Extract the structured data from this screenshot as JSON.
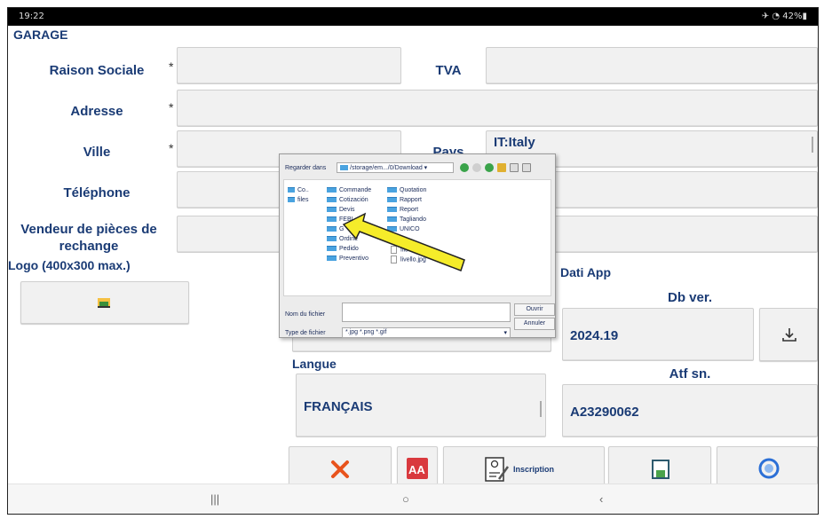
{
  "status_bar": {
    "time": "19:22",
    "battery": "42%"
  },
  "app": {
    "title": "GARAGE"
  },
  "form": {
    "raison_sociale": {
      "label": "Raison Sociale",
      "required": "*"
    },
    "tva": {
      "label": "TVA"
    },
    "adresse": {
      "label": "Adresse",
      "required": "*"
    },
    "ville": {
      "label": "Ville",
      "required": "*"
    },
    "pays": {
      "label": "Pays",
      "value": "IT:Italy"
    },
    "telephone": {
      "label": "Téléphone"
    },
    "vendeur": {
      "label_line1": "Vendeur de pièces de",
      "label_line2": "rechange"
    },
    "logo": {
      "label": "Logo (400x300 max.)"
    }
  },
  "dati_app": {
    "title": "Dati App",
    "db_ver_label": "Db ver.",
    "db_ver_value": "2024.19",
    "atf_label": "Atf sn.",
    "atf_value": "A23290062"
  },
  "langue": {
    "label": "Langue",
    "value": "FRANÇAIS"
  },
  "toolbar": {
    "inscription_label": "Inscription"
  },
  "file_dialog": {
    "look_in_label": "Regarder dans",
    "path": "/storage/em.../0/Download",
    "sidebar": [
      "Co..",
      "files"
    ],
    "folders_col1": [
      "Commande",
      "Cotización",
      "Devis",
      "FEBI",
      "G",
      "Ordine",
      "Pedido",
      "Preventivo"
    ],
    "folders_col2": [
      "Quotation",
      "Rapport",
      "Report",
      "Tagliando",
      "UNICO"
    ],
    "files_col2": [
      "filtro.jpg",
      "livello.jpg"
    ],
    "filename_label": "Nom du fichier",
    "filename_value": "",
    "open_button": "Ouvrir",
    "cancel_button": "Annuler",
    "filetype_label": "Type de fichier",
    "filetype_value": "*.jpg *.png *.gif"
  },
  "colors": {
    "label_blue": "#1a3b75",
    "arrow_yellow": "#f5ec2a",
    "cancel_orange": "#e8531c"
  }
}
